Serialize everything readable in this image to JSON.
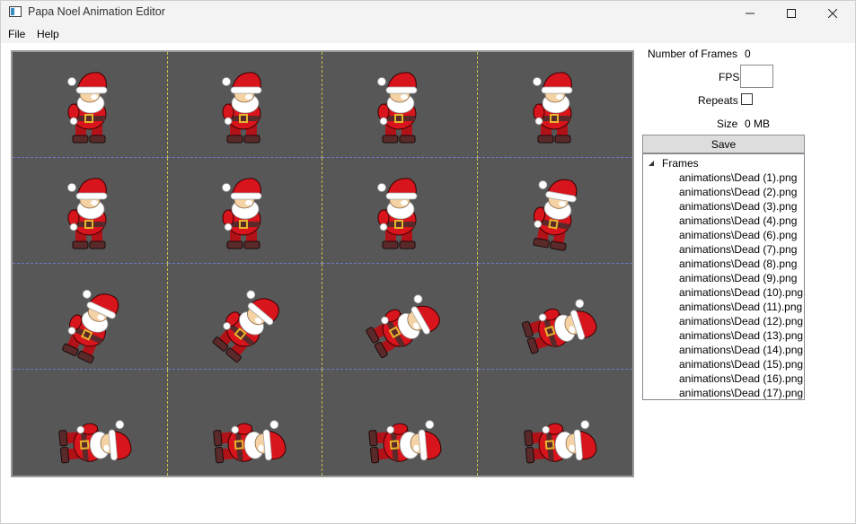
{
  "window": {
    "title": "Papa Noel Animation Editor",
    "controls": [
      "minimize",
      "maximize",
      "close"
    ]
  },
  "menu": {
    "items": [
      "File",
      "Help"
    ]
  },
  "canvas": {
    "background": "#575757",
    "grid_line_colors": [
      "#c9c14a",
      "#6e78c8"
    ],
    "columns": 4,
    "rows": 4,
    "sprites": [
      {
        "pose": "standing",
        "tilt": 0
      },
      {
        "pose": "standing",
        "tilt": 0
      },
      {
        "pose": "standing",
        "tilt": 0
      },
      {
        "pose": "standing",
        "tilt": 0
      },
      {
        "pose": "standing",
        "tilt": 0
      },
      {
        "pose": "standing",
        "tilt": 0
      },
      {
        "pose": "standing",
        "tilt": 0
      },
      {
        "pose": "standing",
        "tilt": 10
      },
      {
        "pose": "falling",
        "tilt": 25
      },
      {
        "pose": "falling",
        "tilt": 40
      },
      {
        "pose": "falling",
        "tilt": 60
      },
      {
        "pose": "falling",
        "tilt": 72
      },
      {
        "pose": "lying",
        "tilt": 85
      },
      {
        "pose": "lying",
        "tilt": 85
      },
      {
        "pose": "lying",
        "tilt": 85
      },
      {
        "pose": "lying",
        "tilt": 85
      }
    ]
  },
  "properties": {
    "frames_label": "Number of Frames",
    "frames_value": "0",
    "fps_label": "FPS",
    "fps_value": "",
    "repeats_label": "Repeats",
    "repeats_checked": false,
    "size_label": "Size",
    "size_value": "0 MB"
  },
  "save_label": "Save",
  "tree": {
    "root_label": "Frames",
    "expanded": true,
    "items": [
      "animations\\Dead (1).png",
      "animations\\Dead (2).png",
      "animations\\Dead (3).png",
      "animations\\Dead (4).png",
      "animations\\Dead (6).png",
      "animations\\Dead (7).png",
      "animations\\Dead (8).png",
      "animations\\Dead (9).png",
      "animations\\Dead (10).png",
      "animations\\Dead (11).png",
      "animations\\Dead (12).png",
      "animations\\Dead (13).png",
      "animations\\Dead (14).png",
      "animations\\Dead (15).png",
      "animations\\Dead (16).png",
      "animations\\Dead (17).png"
    ]
  }
}
